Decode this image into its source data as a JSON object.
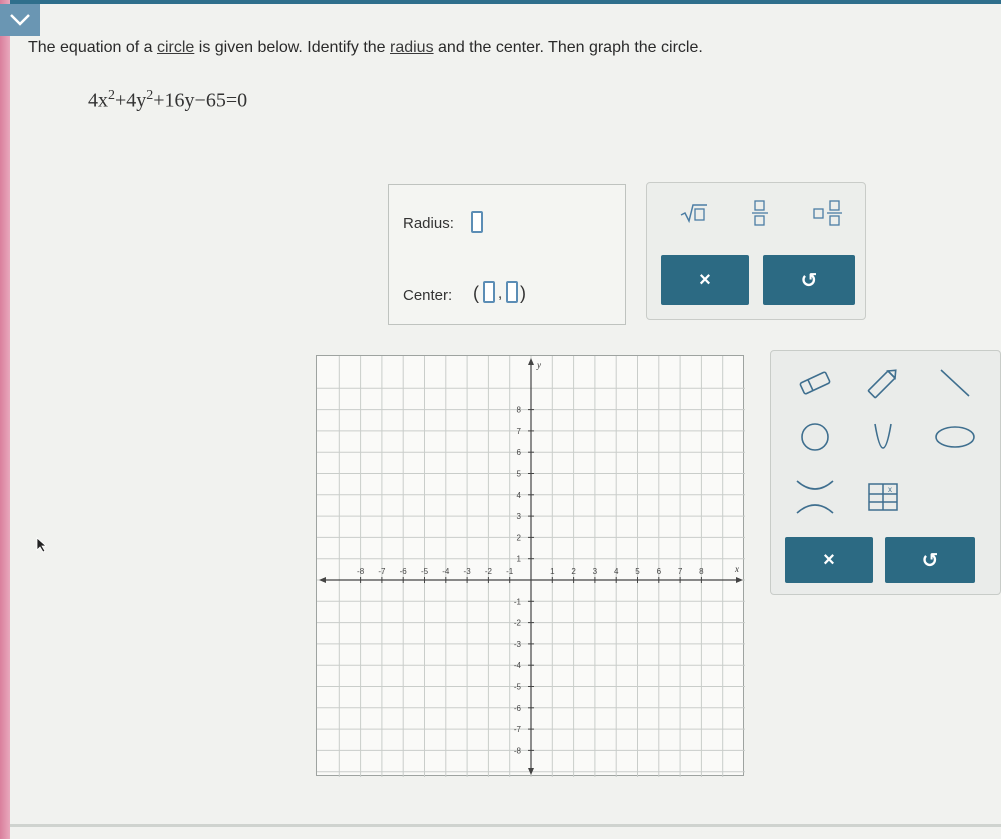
{
  "prompt": {
    "before_circle": "The equation of a ",
    "circle_link": "circle",
    "middle": " is given below. Identify the ",
    "radius_link": "radius",
    "after": " and the center. Then graph the circle."
  },
  "equation": {
    "t1": "4x",
    "e1": "2",
    "t2": "+4y",
    "e2": "2",
    "t3": "+16y−65=0"
  },
  "answer": {
    "radius_label": "Radius:",
    "center_label": "Center:",
    "center_open": "(",
    "center_comma": ",",
    "center_close": ")"
  },
  "palette": {
    "keys": [
      "sqrt-key",
      "fraction-key",
      "mixed-number-key"
    ],
    "clear_symbol": "×",
    "undo_symbol": "↺"
  },
  "graph": {
    "x_ticks": [
      "-8",
      "-7",
      "-6",
      "-5",
      "-4",
      "-3",
      "-2",
      "-1",
      "1",
      "2",
      "3",
      "4",
      "5",
      "6",
      "7",
      "8"
    ],
    "y_ticks": [
      "8",
      "7",
      "6",
      "5",
      "4",
      "3",
      "2",
      "1",
      "-1",
      "-2",
      "-3",
      "-4",
      "-5",
      "-6",
      "-7",
      "-8"
    ],
    "x_label": "x",
    "y_label": "y",
    "range": [
      -9,
      9
    ]
  },
  "tools": {
    "items": [
      "eraser-tool",
      "pencil-tool",
      "line-segment-tool",
      "circle-tool",
      "parabola-tool",
      "ellipse-tool",
      "hyperbola-tool",
      "table-tool"
    ],
    "table_symbol": "x",
    "clear_symbol": "×",
    "undo_symbol": "↺"
  },
  "colors": {
    "accent": "#2c6a83",
    "slot_border": "#5b8db5",
    "grid": "#c9cdca"
  }
}
